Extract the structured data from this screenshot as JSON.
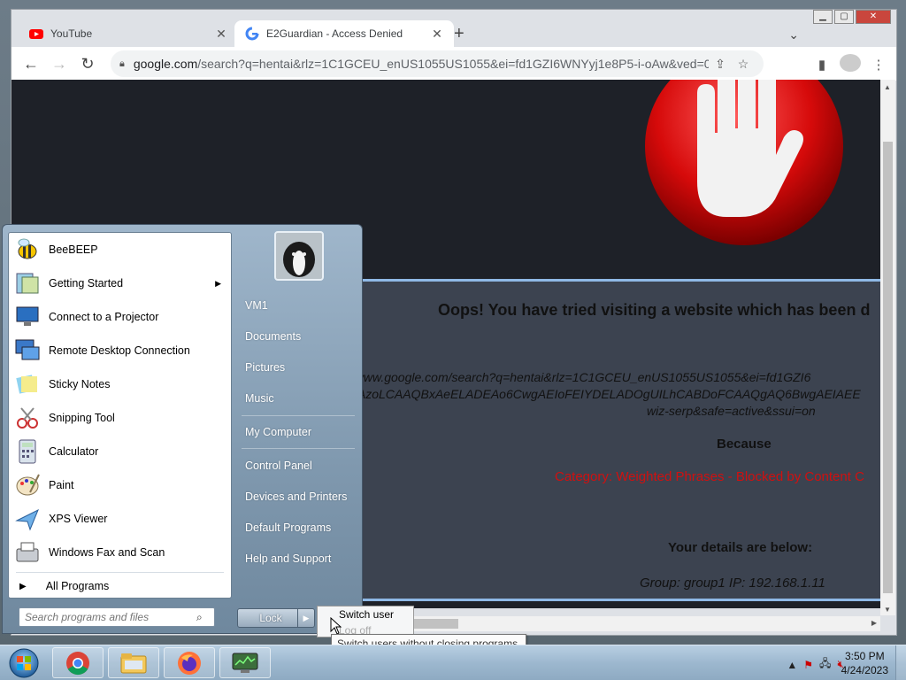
{
  "browser": {
    "tabs": [
      {
        "title": "YouTube",
        "active": false
      },
      {
        "title": "E2Guardian - Access Denied",
        "active": true
      }
    ],
    "url_host": "google.com",
    "url_path": "/search?q=hentai&rlz=1C1GCEU_enUS1055US1055&ei=fd1GZI6WNYyj1e8P5-i-oAw&ved=0ah..."
  },
  "page": {
    "headline": "Oops! You have tried visiting a website which has been d",
    "blocked_url_lines": [
      "//www.google.com/search?q=hentai&rlz=1C1GCEU_enUS1055US1055&ei=fd1GZI6",
      "QAzoLCAAQBxAeELADEAo6CwgAEIoFEIYDELADOgUILhCABDoFCAAQgAQ6BwgAEIAEE",
      "wiz-serp&safe=active&ssui=on"
    ],
    "because": "Because",
    "category": "Category: Weighted Phrases - Blocked by Content C",
    "details_heading": "Your details are below:",
    "group_line": "Group: group1   IP: 192.168.1.11"
  },
  "start_menu": {
    "programs": [
      {
        "label": "BeeBEEP",
        "icon": "bee-icon",
        "submenu": false
      },
      {
        "label": "Getting Started",
        "icon": "getting-started-icon",
        "submenu": true
      },
      {
        "label": "Connect to a Projector",
        "icon": "projector-icon",
        "submenu": false
      },
      {
        "label": "Remote Desktop Connection",
        "icon": "remote-desktop-icon",
        "submenu": false
      },
      {
        "label": "Sticky Notes",
        "icon": "sticky-notes-icon",
        "submenu": false
      },
      {
        "label": "Snipping Tool",
        "icon": "snipping-tool-icon",
        "submenu": false
      },
      {
        "label": "Calculator",
        "icon": "calculator-icon",
        "submenu": false
      },
      {
        "label": "Paint",
        "icon": "paint-icon",
        "submenu": false
      },
      {
        "label": "XPS Viewer",
        "icon": "xps-viewer-icon",
        "submenu": false
      },
      {
        "label": "Windows Fax and Scan",
        "icon": "fax-scan-icon",
        "submenu": false
      }
    ],
    "all_programs": "All Programs",
    "search_placeholder": "Search programs and files",
    "right_links": [
      "VM1",
      "Documents",
      "Pictures",
      "Music",
      "My Computer",
      "Control Panel",
      "Devices and Printers",
      "Default Programs",
      "Help and Support"
    ],
    "lock_label": "Lock",
    "power_submenu": [
      "Switch user",
      "Log off"
    ],
    "tooltip": "Switch users without closing programs."
  },
  "taskbar": {
    "apps": [
      "chrome-icon",
      "explorer-icon",
      "firefox-icon",
      "task-manager-icon"
    ],
    "time": "3:50 PM",
    "date": "4/24/2023"
  }
}
